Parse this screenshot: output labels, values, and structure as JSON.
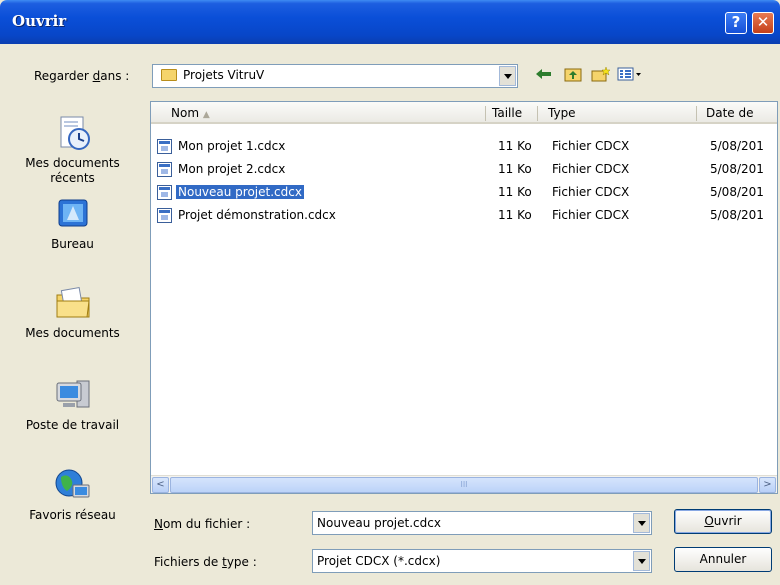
{
  "window": {
    "title": "Ouvrir",
    "help_glyph": "?",
    "close_glyph": "✕"
  },
  "lookin": {
    "label_prefix": "Regarder ",
    "label_accel": "d",
    "label_suffix": "ans :",
    "value": "Projets VitruV",
    "tools": [
      "back-arrow-icon",
      "up-folder-icon",
      "new-folder-icon",
      "views-menu-icon"
    ]
  },
  "places": [
    {
      "label": "Mes documents récents",
      "icon": "recent-documents-icon"
    },
    {
      "label": "Bureau",
      "icon": "desktop-icon"
    },
    {
      "label": "Mes documents",
      "icon": "my-documents-icon"
    },
    {
      "label": "Poste de travail",
      "icon": "my-computer-icon"
    },
    {
      "label": "Favoris réseau",
      "icon": "network-places-icon"
    }
  ],
  "columns": {
    "name": "Nom",
    "size": "Taille",
    "type": "Type",
    "date": "Date de"
  },
  "files": [
    {
      "name": "Mon projet 1.cdcx",
      "size": "11 Ko",
      "type": "Fichier CDCX",
      "date": "5/08/201",
      "selected": false
    },
    {
      "name": "Mon projet 2.cdcx",
      "size": "11 Ko",
      "type": "Fichier CDCX",
      "date": "5/08/201",
      "selected": false
    },
    {
      "name": "Nouveau projet.cdcx",
      "size": "11 Ko",
      "type": "Fichier CDCX",
      "date": "5/08/201",
      "selected": true
    },
    {
      "name": "Projet démonstration.cdcx",
      "size": "11 Ko",
      "type": "Fichier CDCX",
      "date": "5/08/201",
      "selected": false
    }
  ],
  "scroll": {
    "left_glyph": "<",
    "right_glyph": ">",
    "grip": "III"
  },
  "filename": {
    "label_accel": "N",
    "label_rest": "om du fichier :",
    "value": "Nouveau projet.cdcx"
  },
  "filetype": {
    "label_prefix": "Fichiers de ",
    "label_accel": "t",
    "label_suffix": "ype :",
    "value": "Projet CDCX (*.cdcx)"
  },
  "buttons": {
    "open_accel": "O",
    "open_rest": "uvrir",
    "cancel": "Annuler"
  },
  "colors": {
    "titlebar": "#0a4fd8",
    "selection": "#316ac5",
    "dialog_bg": "#ece9d8"
  }
}
